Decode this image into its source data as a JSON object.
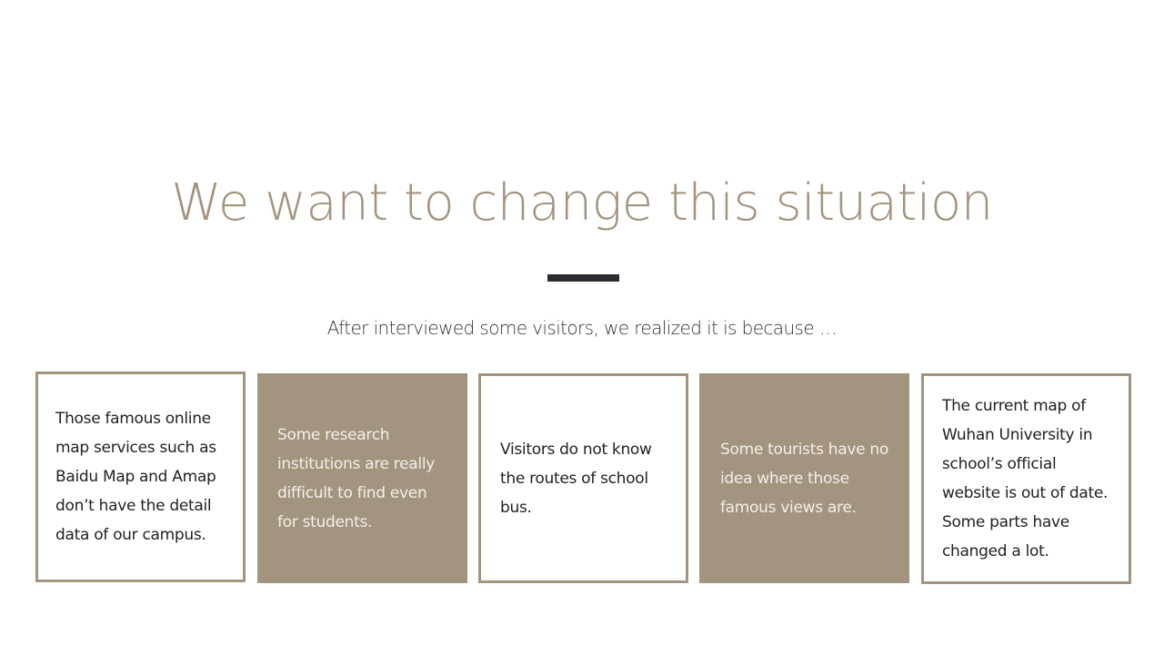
{
  "slide": {
    "title": "We want to change this situation",
    "subtitle": "After interviewed some visitors, we realized it is because …",
    "cards": [
      {
        "text": "Those famous online map services such as Baidu Map and Amap don’t have the detail data of our campus.",
        "style": "outline"
      },
      {
        "text": "Some research institutions are really difficult to find even for students.",
        "style": "filled"
      },
      {
        "text": "Visitors do not know the routes of school bus.",
        "style": "outline"
      },
      {
        "text": "Some tourists have no idea where those famous views are.",
        "style": "filled"
      },
      {
        "text": "The current map of Wuhan University in school’s official website is out of date. Some parts have changed a lot.",
        "style": "outline"
      }
    ]
  },
  "colors": {
    "accent": "#a39480",
    "divider": "#2b2b33",
    "card_text_light": "#f4efe7",
    "background": "#ffffff"
  }
}
